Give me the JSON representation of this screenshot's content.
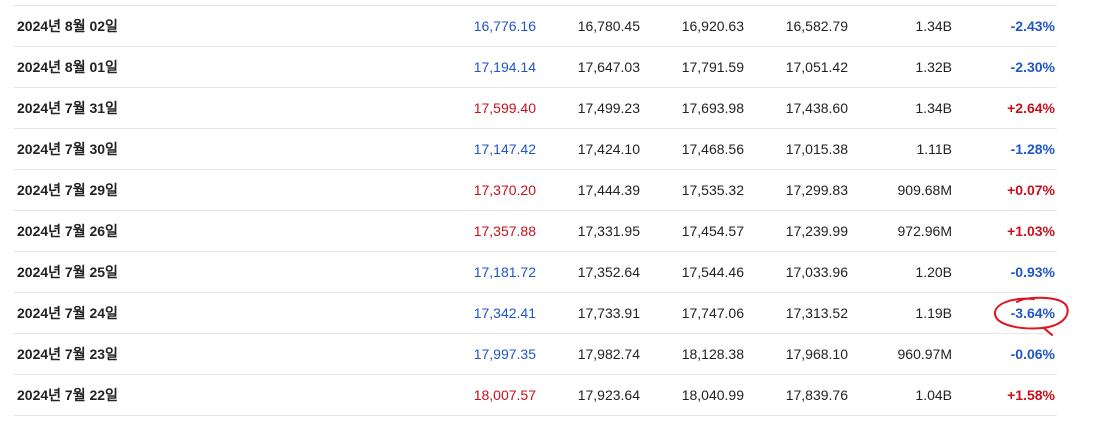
{
  "colors": {
    "down": "#1f56c8",
    "up": "#c8101c",
    "annotation": "#e0141e",
    "divider": "#e6e6e6"
  },
  "rows": [
    {
      "date": "2024년 8월 02일",
      "close": "16,776.16",
      "open": "16,780.45",
      "high": "16,920.63",
      "low": "16,582.79",
      "volume": "1.34B",
      "change": "-2.43%",
      "dir": "down"
    },
    {
      "date": "2024년 8월 01일",
      "close": "17,194.14",
      "open": "17,647.03",
      "high": "17,791.59",
      "low": "17,051.42",
      "volume": "1.32B",
      "change": "-2.30%",
      "dir": "down"
    },
    {
      "date": "2024년 7월 31일",
      "close": "17,599.40",
      "open": "17,499.23",
      "high": "17,693.98",
      "low": "17,438.60",
      "volume": "1.34B",
      "change": "+2.64%",
      "dir": "up"
    },
    {
      "date": "2024년 7월 30일",
      "close": "17,147.42",
      "open": "17,424.10",
      "high": "17,468.56",
      "low": "17,015.38",
      "volume": "1.11B",
      "change": "-1.28%",
      "dir": "down"
    },
    {
      "date": "2024년 7월 29일",
      "close": "17,370.20",
      "open": "17,444.39",
      "high": "17,535.32",
      "low": "17,299.83",
      "volume": "909.68M",
      "change": "+0.07%",
      "dir": "up"
    },
    {
      "date": "2024년 7월 26일",
      "close": "17,357.88",
      "open": "17,331.95",
      "high": "17,454.57",
      "low": "17,239.99",
      "volume": "972.96M",
      "change": "+1.03%",
      "dir": "up"
    },
    {
      "date": "2024년 7월 25일",
      "close": "17,181.72",
      "open": "17,352.64",
      "high": "17,544.46",
      "low": "17,033.96",
      "volume": "1.20B",
      "change": "-0.93%",
      "dir": "down"
    },
    {
      "date": "2024년 7월 24일",
      "close": "17,342.41",
      "open": "17,733.91",
      "high": "17,747.06",
      "low": "17,313.52",
      "volume": "1.19B",
      "change": "-3.64%",
      "dir": "down"
    },
    {
      "date": "2024년 7월 23일",
      "close": "17,997.35",
      "open": "17,982.74",
      "high": "18,128.38",
      "low": "17,968.10",
      "volume": "960.97M",
      "change": "-0.06%",
      "dir": "down"
    },
    {
      "date": "2024년 7월 22일",
      "close": "18,007.57",
      "open": "17,923.64",
      "high": "18,040.99",
      "low": "17,839.76",
      "volume": "1.04B",
      "change": "+1.58%",
      "dir": "up"
    }
  ]
}
